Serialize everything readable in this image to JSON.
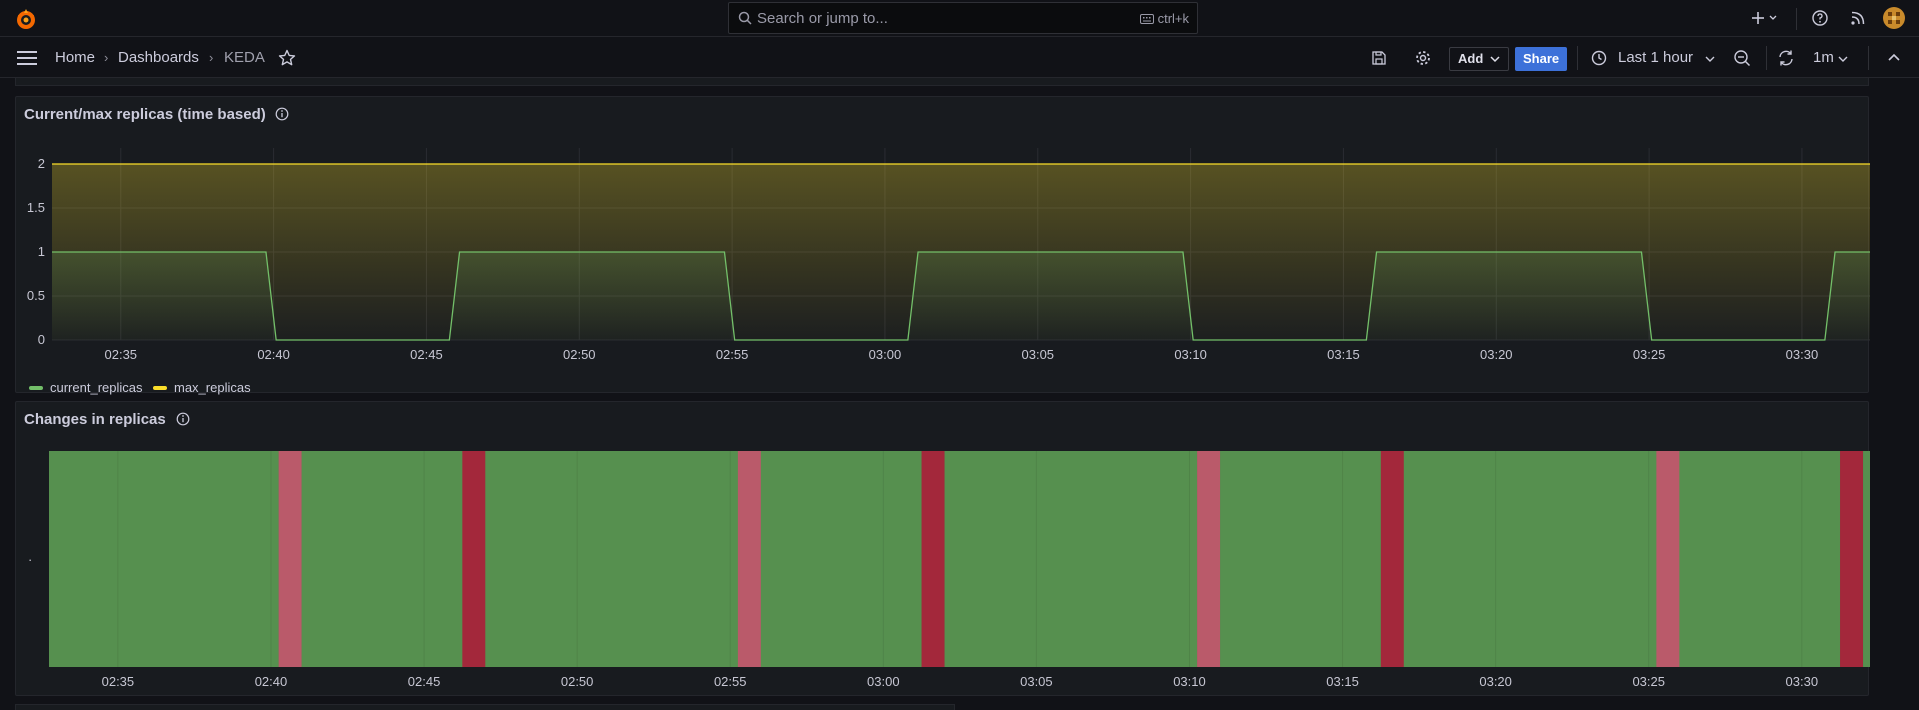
{
  "header": {
    "search_placeholder": "Search or jump to...",
    "search_shortcut": "ctrl+k"
  },
  "breadcrumb": {
    "home": "Home",
    "dashboards": "Dashboards",
    "current": "KEDA"
  },
  "toolbar": {
    "add_label": "Add",
    "share_label": "Share",
    "time_range": "Last 1 hour",
    "refresh_interval": "1m"
  },
  "panels": [
    {
      "title": "Current/max replicas (time based)"
    },
    {
      "title": "Changes in replicas",
      "y_tick": "·"
    }
  ],
  "colors": {
    "current_replicas": "#73bf69",
    "max_replicas": "#fade2a",
    "state_up": "#56904f",
    "state_down_light": "#ba5a6a",
    "state_down_dark": "#a3283b",
    "accent": "#3d71d9"
  },
  "chart_data": [
    {
      "type": "line",
      "title": "Current/max replicas (time based)",
      "x_ticks": [
        "02:35",
        "02:40",
        "02:45",
        "02:50",
        "02:55",
        "03:00",
        "03:05",
        "03:10",
        "03:15",
        "03:20",
        "03:25",
        "03:30"
      ],
      "y_ticks": [
        "0",
        "0.5",
        "1",
        "1.5",
        "2"
      ],
      "ylim": [
        0,
        2
      ],
      "xlim": [
        "02:32:45",
        "03:32:45"
      ],
      "grid": true,
      "legend_position": "bottom-left",
      "series": [
        {
          "name": "current_replicas",
          "x": [
            "02:32:45",
            "02:39:45",
            "02:40:05",
            "02:45:45",
            "02:46:05",
            "02:54:45",
            "02:55:05",
            "03:00:45",
            "03:01:05",
            "03:09:45",
            "03:10:05",
            "03:15:45",
            "03:16:05",
            "03:24:45",
            "03:25:05",
            "03:30:45",
            "03:31:05",
            "03:32:45"
          ],
          "y": [
            1,
            1,
            0,
            0,
            1,
            1,
            0,
            0,
            1,
            1,
            0,
            0,
            1,
            1,
            0,
            0,
            1,
            1
          ]
        },
        {
          "name": "max_replicas",
          "x": [
            "02:32:45",
            "03:32:45"
          ],
          "y": [
            2,
            2
          ]
        }
      ]
    },
    {
      "type": "heatmap",
      "title": "Changes in replicas",
      "x_ticks": [
        "02:35",
        "02:40",
        "02:45",
        "02:50",
        "02:55",
        "03:00",
        "03:05",
        "03:10",
        "03:15",
        "03:20",
        "03:25",
        "03:30"
      ],
      "xlim": [
        "02:32:45",
        "03:32:45"
      ],
      "segments": [
        {
          "start": "02:32:45",
          "end": "02:40:15",
          "state": "up"
        },
        {
          "start": "02:40:15",
          "end": "02:41:00",
          "state": "down_light"
        },
        {
          "start": "02:41:00",
          "end": "02:46:15",
          "state": "up"
        },
        {
          "start": "02:46:15",
          "end": "02:47:00",
          "state": "down_dark"
        },
        {
          "start": "02:47:00",
          "end": "02:55:15",
          "state": "up"
        },
        {
          "start": "02:55:15",
          "end": "02:56:00",
          "state": "down_light"
        },
        {
          "start": "02:56:00",
          "end": "03:01:15",
          "state": "up"
        },
        {
          "start": "03:01:15",
          "end": "03:02:00",
          "state": "down_dark"
        },
        {
          "start": "03:02:00",
          "end": "03:10:15",
          "state": "up"
        },
        {
          "start": "03:10:15",
          "end": "03:11:00",
          "state": "down_light"
        },
        {
          "start": "03:11:00",
          "end": "03:16:15",
          "state": "up"
        },
        {
          "start": "03:16:15",
          "end": "03:17:00",
          "state": "down_dark"
        },
        {
          "start": "03:17:00",
          "end": "03:25:15",
          "state": "up"
        },
        {
          "start": "03:25:15",
          "end": "03:26:00",
          "state": "down_light"
        },
        {
          "start": "03:26:00",
          "end": "03:31:15",
          "state": "up"
        },
        {
          "start": "03:31:15",
          "end": "03:32:00",
          "state": "down_dark"
        },
        {
          "start": "03:32:00",
          "end": "03:32:45",
          "state": "up"
        }
      ]
    }
  ]
}
